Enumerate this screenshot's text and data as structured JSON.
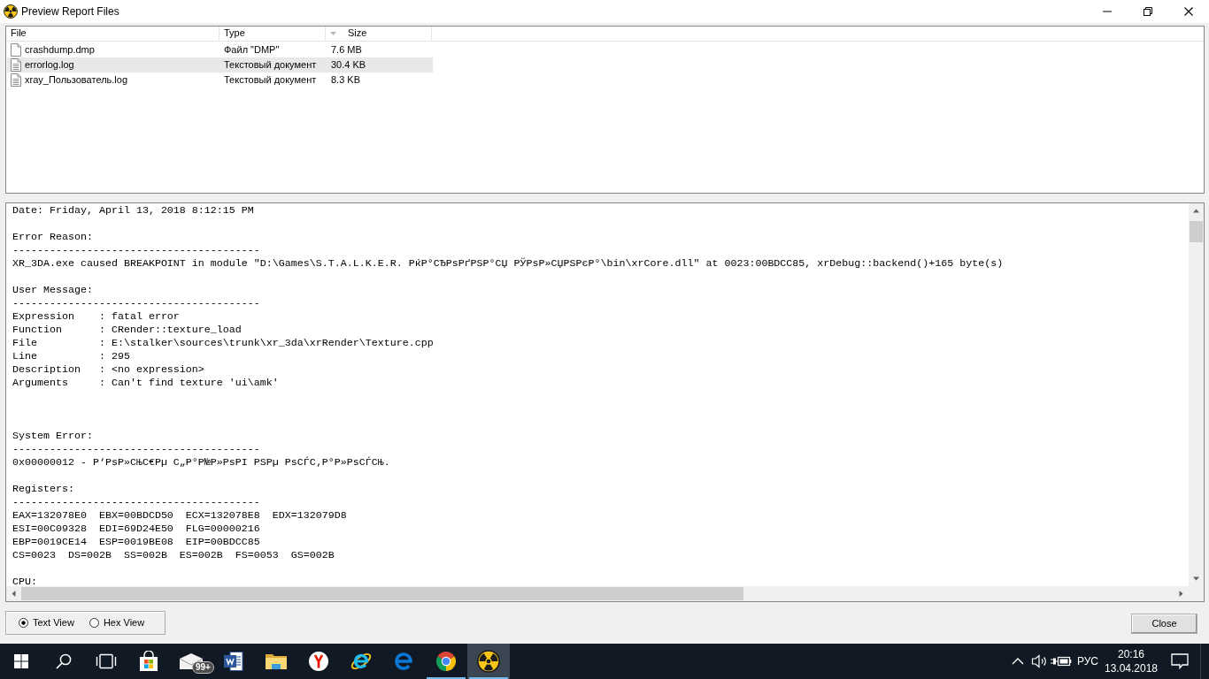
{
  "window": {
    "title": "Preview Report Files"
  },
  "file_list": {
    "columns": [
      {
        "label": "File",
        "sorted": false
      },
      {
        "label": "Type",
        "sorted": false
      },
      {
        "label": "Size",
        "sorted": true
      }
    ],
    "rows": [
      {
        "kind": "plain",
        "name": "crashdump.dmp",
        "type": "Файл \"DMP\"",
        "size": "7.6 MB",
        "selected": false
      },
      {
        "kind": "lines",
        "name": "errorlog.log",
        "type": "Текстовый документ",
        "size": "30.4 KB",
        "selected": true
      },
      {
        "kind": "lines",
        "name": "xray_Пользователь.log",
        "type": "Текстовый документ",
        "size": "8.3 KB",
        "selected": false
      }
    ]
  },
  "report_text": {
    "lines": [
      {
        "kind": "text",
        "text": "Date: Friday, April 13, 2018 8:12:15 PM"
      },
      {
        "kind": "blank"
      },
      {
        "kind": "text",
        "text": "Error Reason:"
      },
      {
        "kind": "text",
        "text": "----------------------------------------"
      },
      {
        "kind": "text",
        "text": "XR_3DA.exe caused BREAKPOINT in module \"D:\\Games\\S.T.A.L.K.E.R. РќР°СЂРѕРґРЅР°СЏ РЎРѕР»СЏРЅРєР°\\bin\\xrCore.dll\" at 0023:00BDCC85, xrDebug::backend()+165 byte(s)"
      },
      {
        "kind": "blank"
      },
      {
        "kind": "text",
        "text": "User Message:"
      },
      {
        "kind": "text",
        "text": "----------------------------------------"
      },
      {
        "kind": "text",
        "text": "Expression    : fatal error"
      },
      {
        "kind": "text",
        "text": "Function      : CRender::texture_load"
      },
      {
        "kind": "text",
        "text": "File          : E:\\stalker\\sources\\trunk\\xr_3da\\xrRender\\Texture.cpp"
      },
      {
        "kind": "text",
        "text": "Line          : 295"
      },
      {
        "kind": "text",
        "text": "Description   : <no expression>"
      },
      {
        "kind": "text",
        "text": "Arguments     : Can't find texture 'ui\\amk'"
      },
      {
        "kind": "blank"
      },
      {
        "kind": "blank"
      },
      {
        "kind": "blank"
      },
      {
        "kind": "text",
        "text": "System Error:"
      },
      {
        "kind": "text",
        "text": "----------------------------------------"
      },
      {
        "kind": "text",
        "text": "0x00000012 - Р‘РѕР»СЊС€Рµ С„Р°Р№Р»РѕРІ РЅРµ РѕСЃС‚Р°Р»РѕСЃСЊ."
      },
      {
        "kind": "blank"
      },
      {
        "kind": "text",
        "text": "Registers:"
      },
      {
        "kind": "text",
        "text": "----------------------------------------"
      },
      {
        "kind": "text",
        "text": "EAX=132078E0  EBX=00BDCD50  ECX=132078E8  EDX=132079D8"
      },
      {
        "kind": "text",
        "text": "ESI=00C09328  EDI=69D24E50  FLG=00000216"
      },
      {
        "kind": "text",
        "text": "EBP=0019CE14  ESP=0019BE08  EIP=00BDCC85"
      },
      {
        "kind": "text",
        "text": "CS=0023  DS=002B  SS=002B  ES=002B  FS=0053  GS=002B"
      },
      {
        "kind": "blank"
      },
      {
        "kind": "text",
        "text": "CPU:"
      }
    ]
  },
  "view_modes": [
    {
      "label": "Text View",
      "selected": true
    },
    {
      "label": "Hex View",
      "selected": false
    }
  ],
  "close_button": {
    "label": "Close"
  },
  "taskbar": {
    "apps": [
      {
        "kind": "windows",
        "running": false,
        "active": false
      },
      {
        "kind": "search",
        "running": false,
        "active": false
      },
      {
        "kind": "taskview",
        "running": false,
        "active": false
      },
      {
        "kind": "bag",
        "running": false,
        "active": false
      },
      {
        "kind": "envelope",
        "badge": "99+",
        "running": false,
        "active": false
      },
      {
        "kind": "docblue",
        "running": false,
        "active": false
      },
      {
        "kind": "folder",
        "running": false,
        "active": false
      },
      {
        "kind": "ycircle",
        "running": false,
        "active": false
      },
      {
        "kind": "eorbit",
        "running": false,
        "active": false
      },
      {
        "kind": "eswoosh",
        "running": false,
        "active": false
      },
      {
        "kind": "ring",
        "running": true,
        "active": false
      },
      {
        "kind": "radiation",
        "running": true,
        "active": true
      }
    ],
    "tray": {
      "language": "РУС",
      "time": "20:16",
      "date": "13.04.2018"
    }
  }
}
